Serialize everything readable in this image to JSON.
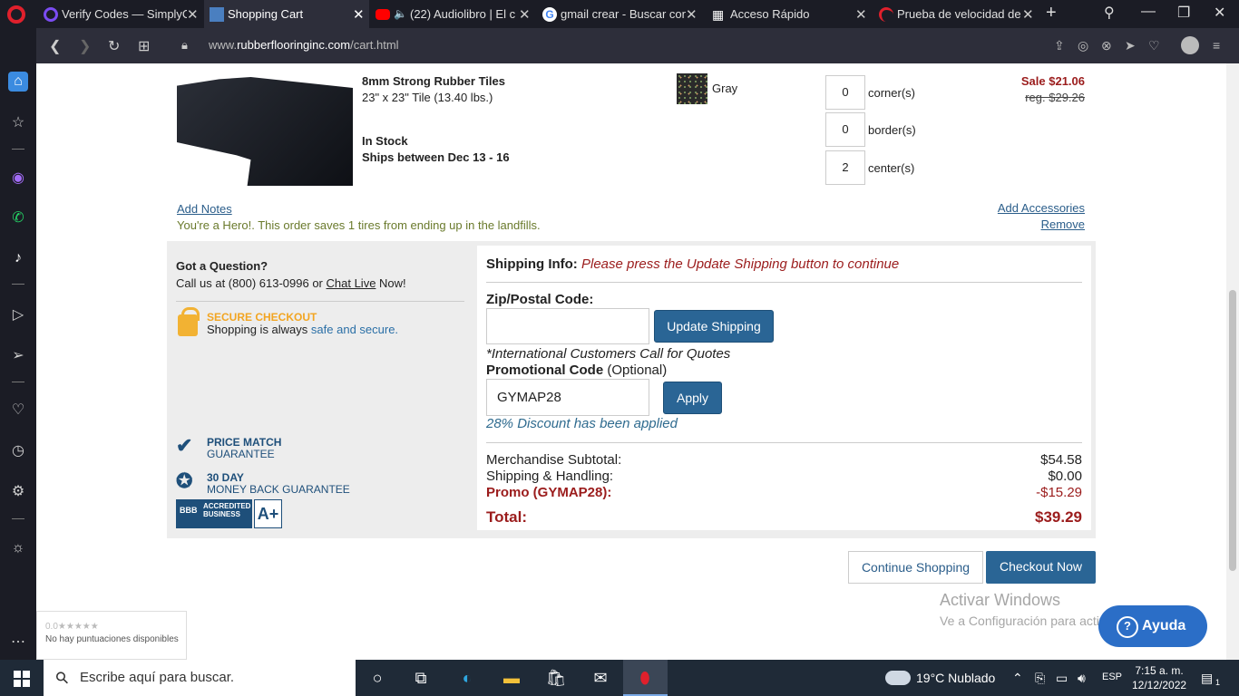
{
  "browser": {
    "tabs": [
      {
        "title": "Verify Codes — SimplyC",
        "icon": "simplycodes-icon",
        "color": "#7b4cf2"
      },
      {
        "title": "Shopping Cart",
        "icon": "rubberflooring-icon",
        "color": "#4a7fc0"
      },
      {
        "title": "(22) Audiolibro | El c",
        "icon": "youtube-icon",
        "color": "#ff0000"
      },
      {
        "title": "gmail crear - Buscar con",
        "icon": "google-icon",
        "color": "#ffffff"
      },
      {
        "title": "Acceso Rápido",
        "icon": "grid-icon",
        "color": "#ffffff"
      },
      {
        "title": "Prueba de velocidad de I",
        "icon": "speedtest-icon",
        "color": "#e0202c"
      }
    ],
    "url_prefix": "www.",
    "url_domain": "rubberflooringinc.com",
    "url_path": "/cart.html"
  },
  "product": {
    "name": "8mm Strong Rubber Tiles",
    "size": "23\" x 23\" Tile (13.40 lbs.)",
    "stock": "In Stock",
    "ships": "Ships between Dec 13 - 16",
    "color": "Gray",
    "quantities": [
      {
        "value": "0",
        "label": "corner(s)"
      },
      {
        "value": "0",
        "label": "border(s)"
      },
      {
        "value": "2",
        "label": "center(s)"
      }
    ],
    "sale_price": "Sale $21.06",
    "reg_price": "reg. $29.26",
    "add_notes": "Add Notes",
    "hero_msg": "You're a Hero!. This order saves 1 tires from ending up in the landfills.",
    "add_accessories": "Add Accessories",
    "remove": "Remove"
  },
  "help": {
    "question": "Got a Question?",
    "call_prefix": "Call us at (800) 613-0996 or",
    "chat": "Chat Live",
    "call_suffix": "Now!",
    "secure_title": "SECURE CHECKOUT",
    "secure_prefix": "Shopping is always",
    "secure_link": "safe and secure.",
    "price_match_1": "PRICE MATCH",
    "price_match_2": "GUARANTEE",
    "money_back_1": "30 DAY",
    "money_back_2": "MONEY BACK GUARANTEE",
    "bbb_text": "ACCREDITED BUSINESS",
    "bbb_rating": "A+"
  },
  "shipping": {
    "label": "Shipping Info:",
    "note": "Please press the Update Shipping button to continue",
    "zip_label": "Zip/Postal Code:",
    "zip_value": "",
    "update_button": "Update Shipping",
    "intl_note": "*International Customers Call for Quotes",
    "promo_label": "Promotional Code",
    "promo_optional": "(Optional)",
    "promo_value": "GYMAP28",
    "apply_button": "Apply",
    "discount_msg": "28% Discount has been applied"
  },
  "totals": {
    "subtotal_label": "Merchandise Subtotal:",
    "subtotal": "$54.58",
    "shipping_label": "Shipping & Handling:",
    "shipping": "$0.00",
    "promo_label": "Promo (GYMAP28):",
    "promo": "-$15.29",
    "total_label": "Total:",
    "total": "$39.29"
  },
  "actions": {
    "continue": "Continue Shopping",
    "checkout": "Checkout Now"
  },
  "overlay": {
    "activate_title": "Activar Windows",
    "activate_sub": "Ve a Configuración para activar Windows.",
    "help_button": "Ayuda",
    "rating_stars": "0.0★★★★★",
    "rating_text": "No hay puntuaciones disponibles"
  },
  "taskbar": {
    "search_placeholder": "Escribe aquí para buscar.",
    "weather": "19°C  Nublado",
    "lang": "ESP",
    "time": "7:15 a. m.",
    "date": "12/12/2022",
    "notifications": "1"
  }
}
